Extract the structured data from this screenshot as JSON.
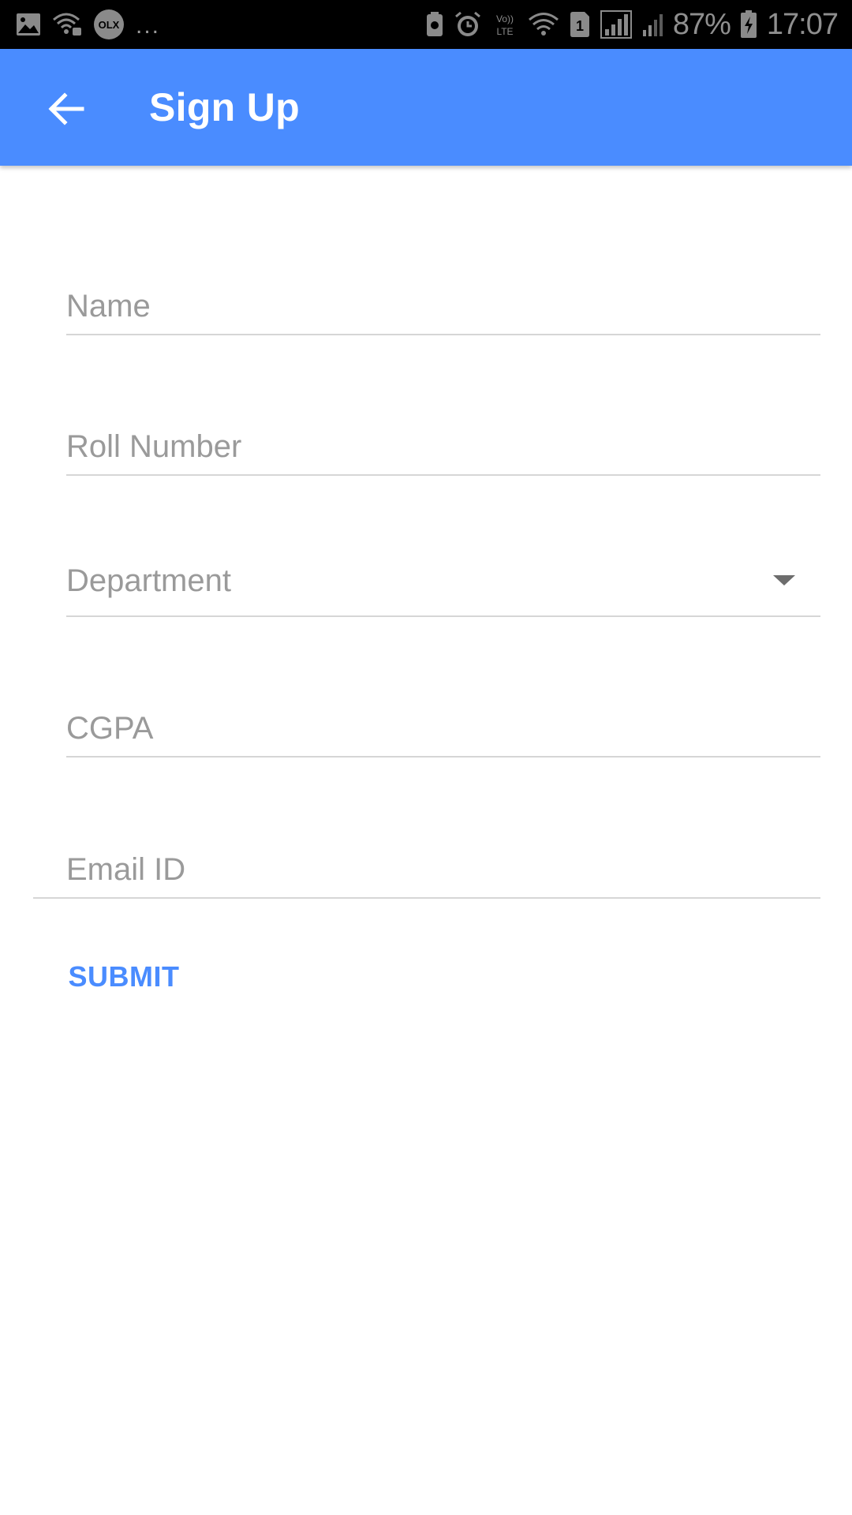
{
  "status_bar": {
    "left_icons": [
      "gallery-icon",
      "wifi-lock-icon",
      "olx-icon"
    ],
    "overflow": "...",
    "right_icons": [
      "battery-saver-icon",
      "alarm-icon",
      "volte-icon",
      "wifi-icon",
      "sim-1-icon",
      "signal-icon",
      "signal-2-icon",
      "charging-battery-icon"
    ],
    "volte_label": "Vo)) LTE",
    "sim_label": "1",
    "battery": "87%",
    "time": "17:07"
  },
  "app_bar": {
    "title": "Sign Up",
    "back_icon": "arrow-back-icon",
    "color": "#4a8cff"
  },
  "form": {
    "name_placeholder": "Name",
    "roll_number_placeholder": "Roll Number",
    "department_placeholder": "Department",
    "cgpa_placeholder": "CGPA",
    "email_placeholder": "Email ID",
    "submit_label": "SUBMIT"
  }
}
